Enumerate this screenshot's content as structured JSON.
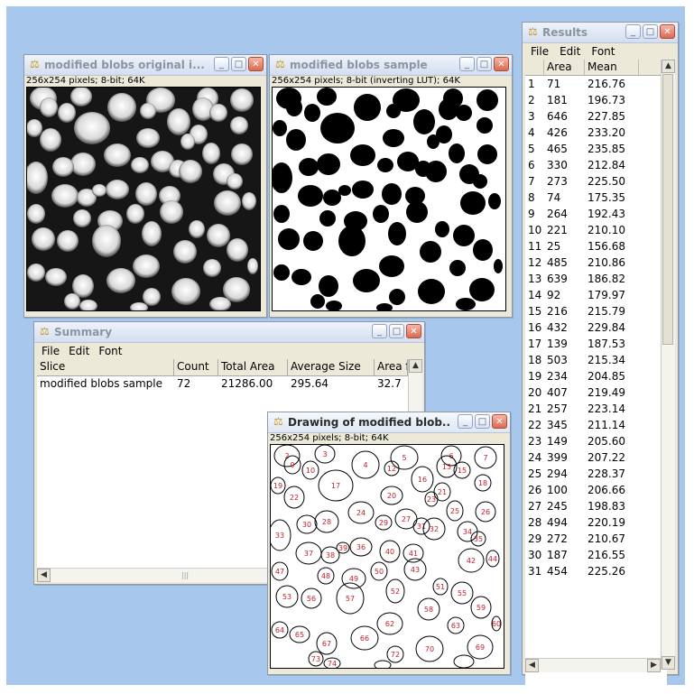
{
  "windows": {
    "original": {
      "title": "modified blobs original i...",
      "subtitle": "256x254 pixels; 8-bit; 64K"
    },
    "sample": {
      "title": "modified blobs sample",
      "subtitle": "256x254 pixels; 8-bit (inverting LUT); 64K"
    },
    "summary": {
      "title": "Summary",
      "menu": [
        "File",
        "Edit",
        "Font"
      ],
      "columns": [
        "Slice",
        "Count",
        "Total Area",
        "Average Size",
        "Area f"
      ],
      "row": [
        "modified blobs sample",
        "72",
        "21286.00",
        "295.64",
        "32.7"
      ]
    },
    "drawing": {
      "title": "Drawing of modified blob...",
      "subtitle": "256x254 pixels; 8-bit; 64K",
      "labels": [
        "2",
        "3",
        "4",
        "5",
        "6",
        "7",
        "9",
        "10",
        "12",
        "13",
        "15",
        "16",
        "17",
        "18",
        "19",
        "20",
        "21",
        "22",
        "23",
        "24",
        "25",
        "26",
        "27",
        "28",
        "29",
        "30",
        "31",
        "32",
        "33",
        "34",
        "35",
        "36",
        "37",
        "38",
        "39",
        "40",
        "41",
        "42",
        "43",
        "44",
        "47",
        "48",
        "49",
        "50",
        "51",
        "52",
        "53",
        "55",
        "56",
        "57",
        "58",
        "59",
        "60",
        "62",
        "63",
        "64",
        "65",
        "66",
        "67",
        "69",
        "70",
        "72",
        "73",
        "74"
      ]
    },
    "results": {
      "title": "Results",
      "menu": [
        "File",
        "Edit",
        "Font"
      ],
      "columns": [
        "",
        "Area",
        "Mean"
      ],
      "rows": [
        [
          "1",
          "71",
          "216.76"
        ],
        [
          "2",
          "181",
          "196.73"
        ],
        [
          "3",
          "646",
          "227.85"
        ],
        [
          "4",
          "426",
          "233.20"
        ],
        [
          "5",
          "465",
          "235.85"
        ],
        [
          "6",
          "330",
          "212.84"
        ],
        [
          "7",
          "273",
          "225.50"
        ],
        [
          "8",
          "74",
          "175.35"
        ],
        [
          "9",
          "264",
          "192.43"
        ],
        [
          "10",
          "221",
          "210.10"
        ],
        [
          "11",
          "25",
          "156.68"
        ],
        [
          "12",
          "485",
          "210.86"
        ],
        [
          "13",
          "639",
          "186.82"
        ],
        [
          "14",
          "92",
          "179.97"
        ],
        [
          "15",
          "216",
          "215.79"
        ],
        [
          "16",
          "432",
          "229.84"
        ],
        [
          "17",
          "139",
          "187.53"
        ],
        [
          "18",
          "503",
          "215.34"
        ],
        [
          "19",
          "234",
          "204.85"
        ],
        [
          "20",
          "407",
          "219.49"
        ],
        [
          "21",
          "257",
          "223.14"
        ],
        [
          "22",
          "345",
          "211.14"
        ],
        [
          "23",
          "149",
          "205.60"
        ],
        [
          "24",
          "399",
          "207.22"
        ],
        [
          "25",
          "294",
          "228.37"
        ],
        [
          "26",
          "100",
          "206.66"
        ],
        [
          "27",
          "245",
          "198.83"
        ],
        [
          "28",
          "494",
          "220.19"
        ],
        [
          "29",
          "272",
          "210.67"
        ],
        [
          "30",
          "187",
          "216.55"
        ],
        [
          "31",
          "454",
          "225.26"
        ]
      ]
    }
  }
}
